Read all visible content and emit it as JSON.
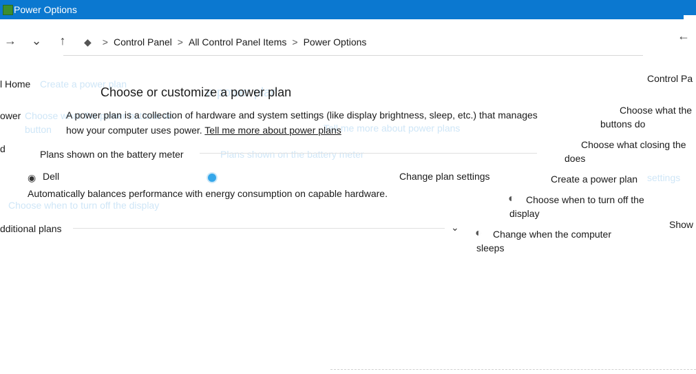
{
  "window": {
    "title": "Power Options"
  },
  "nav": {
    "back_glyph": "←",
    "forward_glyph": "→",
    "recent_glyph": "⌄",
    "up_glyph": "↑",
    "refresh_glyph": "↻"
  },
  "breadcrumb": {
    "icon": "control-panel-icon",
    "items": [
      "Control Panel",
      "All Control Panel Items",
      "Power Options"
    ],
    "separator": ">"
  },
  "left": {
    "home": "l Home",
    "cut_a": "ower",
    "cut_b": "d",
    "ghost_a": "button",
    "ghost_b": "Create a power plan",
    "ghost_c": "Choose when to turn off the display",
    "additional": "dditional plans"
  },
  "main": {
    "title": "Choose or customize a power plan",
    "ghost_title": "a power plan",
    "description": "A power plan is a collection of hardware and system settings (like display brightness, sleep, etc.) that manages how your computer uses power.",
    "learn_more": "Tell me more about power plans",
    "ghost_desc": "Choose what the power buttons do",
    "ghost_learn": "Tell me more about power plans",
    "section_label": "Plans shown on the battery meter",
    "section_ghost": "Plans shown on the battery meter"
  },
  "plan": {
    "name": "Dell",
    "selected": true,
    "change_link": "Change plan settings",
    "description": "Automatically balances performance with energy consumption on capable hardware."
  },
  "right": {
    "top": "Control Pa",
    "power_buttons_a": "Choose what the",
    "power_buttons_b": "buttons do",
    "lid_a": "Choose what closing the",
    "lid_b": "does",
    "create_plan": "Create a power plan",
    "ghost_settings": "settings",
    "display_a": "Choose when to turn off the",
    "display_b": "display",
    "show": "Show",
    "sleep_a": "Change when the computer",
    "sleep_b": "sleeps"
  },
  "colors": {
    "titlebar": "#0b78d0",
    "link": "#1a1a1a",
    "ghost": "#cfe6f7"
  }
}
